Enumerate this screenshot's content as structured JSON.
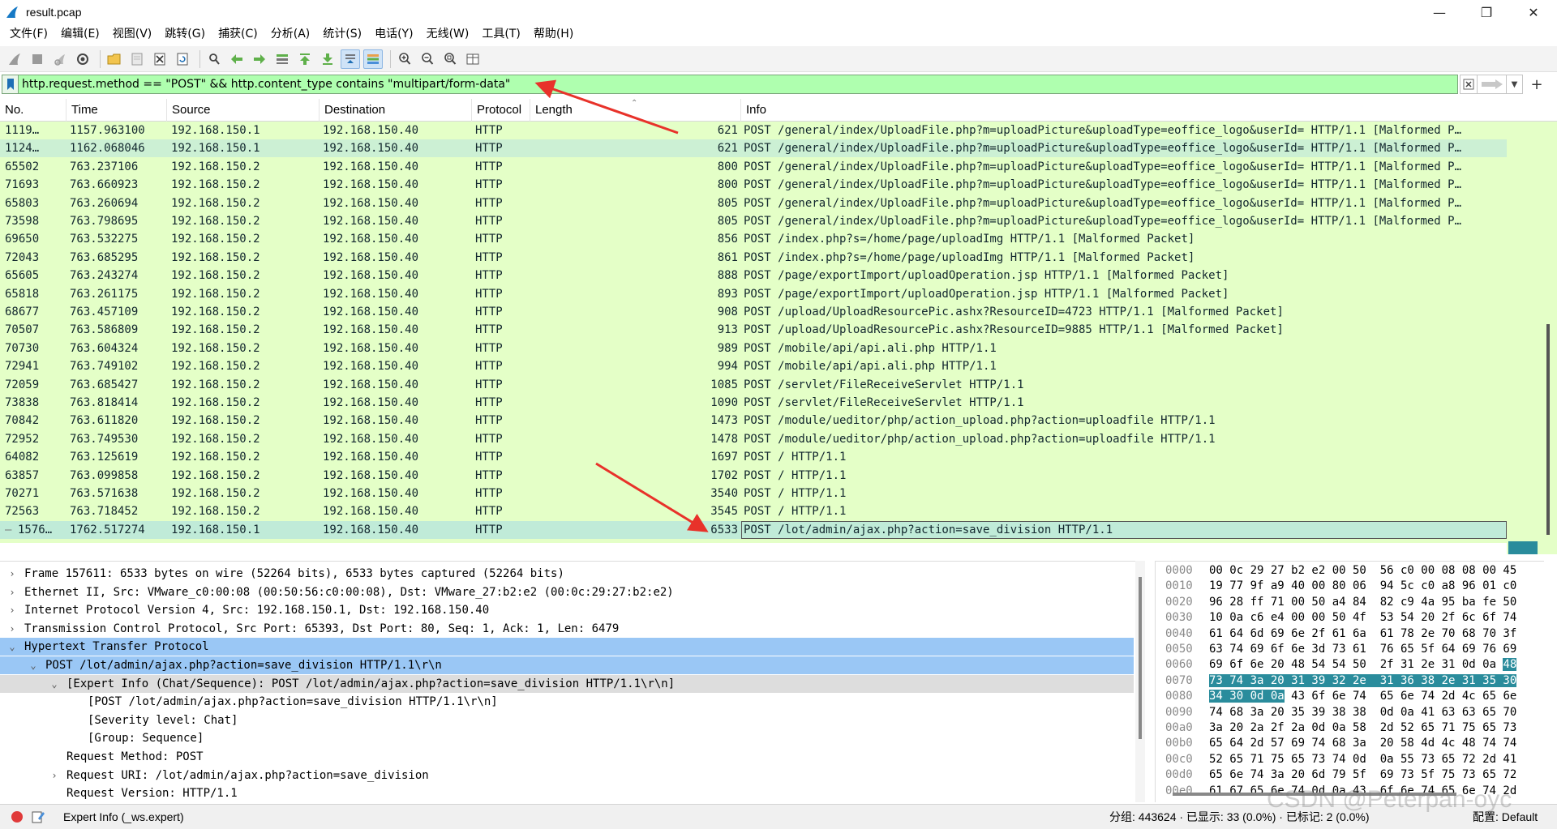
{
  "window": {
    "title": "result.pcap",
    "minimize": "—",
    "restore": "❐",
    "close": "✕"
  },
  "menu": [
    "文件(F)",
    "编辑(E)",
    "视图(V)",
    "跳转(G)",
    "捕获(C)",
    "分析(A)",
    "统计(S)",
    "电话(Y)",
    "无线(W)",
    "工具(T)",
    "帮助(H)"
  ],
  "toolbar_icons": [
    "shark-fin-start-icon",
    "stop-icon",
    "restart-icon",
    "capture-options-icon",
    "open-folder-icon",
    "save-file-icon",
    "close-file-icon",
    "reload-icon",
    "find-packet-icon",
    "go-back-icon",
    "go-forward-icon",
    "go-to-packet-icon",
    "go-first-icon",
    "go-last-icon",
    "autoscroll-icon",
    "colorize-icon",
    "zoom-in-icon",
    "zoom-out-icon",
    "zoom-reset-icon",
    "resize-columns-icon"
  ],
  "filter": {
    "value": "http.request.method == \"POST\" && http.content_type contains \"multipart/form-data\"",
    "plus": "+"
  },
  "columns": [
    "No.",
    "Time",
    "Source",
    "Destination",
    "Protocol",
    "Length",
    "Info"
  ],
  "packets": [
    {
      "no": "1119…",
      "time": "1157.963100",
      "src": "192.168.150.1",
      "dst": "192.168.150.40",
      "proto": "HTTP",
      "len": "621",
      "info": "POST /general/index/UploadFile.php?m=uploadPicture&uploadType=eoffice_logo&userId= HTTP/1.1 [Malformed P…"
    },
    {
      "no": "1124…",
      "time": "1162.068046",
      "src": "192.168.150.1",
      "dst": "192.168.150.40",
      "proto": "HTTP",
      "len": "621",
      "info": "POST /general/index/UploadFile.php?m=uploadPicture&uploadType=eoffice_logo&userId= HTTP/1.1 [Malformed P…"
    },
    {
      "no": "65502",
      "time": "763.237106",
      "src": "192.168.150.2",
      "dst": "192.168.150.40",
      "proto": "HTTP",
      "len": "800",
      "info": "POST /general/index/UploadFile.php?m=uploadPicture&uploadType=eoffice_logo&userId= HTTP/1.1 [Malformed P…"
    },
    {
      "no": "71693",
      "time": "763.660923",
      "src": "192.168.150.2",
      "dst": "192.168.150.40",
      "proto": "HTTP",
      "len": "800",
      "info": "POST /general/index/UploadFile.php?m=uploadPicture&uploadType=eoffice_logo&userId= HTTP/1.1 [Malformed P…"
    },
    {
      "no": "65803",
      "time": "763.260694",
      "src": "192.168.150.2",
      "dst": "192.168.150.40",
      "proto": "HTTP",
      "len": "805",
      "info": "POST /general/index/UploadFile.php?m=uploadPicture&uploadType=eoffice_logo&userId= HTTP/1.1 [Malformed P…"
    },
    {
      "no": "73598",
      "time": "763.798695",
      "src": "192.168.150.2",
      "dst": "192.168.150.40",
      "proto": "HTTP",
      "len": "805",
      "info": "POST /general/index/UploadFile.php?m=uploadPicture&uploadType=eoffice_logo&userId= HTTP/1.1 [Malformed P…"
    },
    {
      "no": "69650",
      "time": "763.532275",
      "src": "192.168.150.2",
      "dst": "192.168.150.40",
      "proto": "HTTP",
      "len": "856",
      "info": "POST /index.php?s=/home/page/uploadImg HTTP/1.1 [Malformed Packet]"
    },
    {
      "no": "72043",
      "time": "763.685295",
      "src": "192.168.150.2",
      "dst": "192.168.150.40",
      "proto": "HTTP",
      "len": "861",
      "info": "POST /index.php?s=/home/page/uploadImg HTTP/1.1 [Malformed Packet]"
    },
    {
      "no": "65605",
      "time": "763.243274",
      "src": "192.168.150.2",
      "dst": "192.168.150.40",
      "proto": "HTTP",
      "len": "888",
      "info": "POST /page/exportImport/uploadOperation.jsp HTTP/1.1 [Malformed Packet]"
    },
    {
      "no": "65818",
      "time": "763.261175",
      "src": "192.168.150.2",
      "dst": "192.168.150.40",
      "proto": "HTTP",
      "len": "893",
      "info": "POST /page/exportImport/uploadOperation.jsp HTTP/1.1 [Malformed Packet]"
    },
    {
      "no": "68677",
      "time": "763.457109",
      "src": "192.168.150.2",
      "dst": "192.168.150.40",
      "proto": "HTTP",
      "len": "908",
      "info": "POST /upload/UploadResourcePic.ashx?ResourceID=4723 HTTP/1.1 [Malformed Packet]"
    },
    {
      "no": "70507",
      "time": "763.586809",
      "src": "192.168.150.2",
      "dst": "192.168.150.40",
      "proto": "HTTP",
      "len": "913",
      "info": "POST /upload/UploadResourcePic.ashx?ResourceID=9885 HTTP/1.1 [Malformed Packet]"
    },
    {
      "no": "70730",
      "time": "763.604324",
      "src": "192.168.150.2",
      "dst": "192.168.150.40",
      "proto": "HTTP",
      "len": "989",
      "info": "POST /mobile/api/api.ali.php HTTP/1.1"
    },
    {
      "no": "72941",
      "time": "763.749102",
      "src": "192.168.150.2",
      "dst": "192.168.150.40",
      "proto": "HTTP",
      "len": "994",
      "info": "POST /mobile/api/api.ali.php HTTP/1.1"
    },
    {
      "no": "72059",
      "time": "763.685427",
      "src": "192.168.150.2",
      "dst": "192.168.150.40",
      "proto": "HTTP",
      "len": "1085",
      "info": "POST /servlet/FileReceiveServlet HTTP/1.1"
    },
    {
      "no": "73838",
      "time": "763.818414",
      "src": "192.168.150.2",
      "dst": "192.168.150.40",
      "proto": "HTTP",
      "len": "1090",
      "info": "POST /servlet/FileReceiveServlet HTTP/1.1"
    },
    {
      "no": "70842",
      "time": "763.611820",
      "src": "192.168.150.2",
      "dst": "192.168.150.40",
      "proto": "HTTP",
      "len": "1473",
      "info": "POST /module/ueditor/php/action_upload.php?action=uploadfile HTTP/1.1"
    },
    {
      "no": "72952",
      "time": "763.749530",
      "src": "192.168.150.2",
      "dst": "192.168.150.40",
      "proto": "HTTP",
      "len": "1478",
      "info": "POST /module/ueditor/php/action_upload.php?action=uploadfile HTTP/1.1"
    },
    {
      "no": "64082",
      "time": "763.125619",
      "src": "192.168.150.2",
      "dst": "192.168.150.40",
      "proto": "HTTP",
      "len": "1697",
      "info": "POST / HTTP/1.1"
    },
    {
      "no": "63857",
      "time": "763.099858",
      "src": "192.168.150.2",
      "dst": "192.168.150.40",
      "proto": "HTTP",
      "len": "1702",
      "info": "POST / HTTP/1.1"
    },
    {
      "no": "70271",
      "time": "763.571638",
      "src": "192.168.150.2",
      "dst": "192.168.150.40",
      "proto": "HTTP",
      "len": "3540",
      "info": "POST / HTTP/1.1"
    },
    {
      "no": "72563",
      "time": "763.718452",
      "src": "192.168.150.2",
      "dst": "192.168.150.40",
      "proto": "HTTP",
      "len": "3545",
      "info": "POST / HTTP/1.1"
    },
    {
      "no": "1576…",
      "time": "1762.517274",
      "src": "192.168.150.1",
      "dst": "192.168.150.40",
      "proto": "HTTP",
      "len": "6533",
      "info": "POST /lot/admin/ajax.php?action=save_division HTTP/1.1"
    }
  ],
  "selected_packet_index": 22,
  "details": [
    {
      "text": "Frame 157611: 6533 bytes on wire (52264 bits), 6533 bytes captured (52264 bits)",
      "arrow": ">",
      "indent": 0,
      "style": ""
    },
    {
      "text": "Ethernet II, Src: VMware_c0:00:08 (00:50:56:c0:00:08), Dst: VMware_27:b2:e2 (00:0c:29:27:b2:e2)",
      "arrow": ">",
      "indent": 0,
      "style": ""
    },
    {
      "text": "Internet Protocol Version 4, Src: 192.168.150.1, Dst: 192.168.150.40",
      "arrow": ">",
      "indent": 0,
      "style": ""
    },
    {
      "text": "Transmission Control Protocol, Src Port: 65393, Dst Port: 80, Seq: 1, Ack: 1, Len: 6479",
      "arrow": ">",
      "indent": 0,
      "style": ""
    },
    {
      "text": "Hypertext Transfer Protocol",
      "arrow": "v",
      "indent": 0,
      "style": "blue"
    },
    {
      "text": "POST /lot/admin/ajax.php?action=save_division HTTP/1.1\\r\\n",
      "arrow": "v",
      "indent": 1,
      "style": "blue"
    },
    {
      "text": "[Expert Info (Chat/Sequence): POST /lot/admin/ajax.php?action=save_division HTTP/1.1\\r\\n]",
      "arrow": "v",
      "indent": 2,
      "style": "gray"
    },
    {
      "text": "[POST /lot/admin/ajax.php?action=save_division HTTP/1.1\\r\\n]",
      "arrow": "",
      "indent": 3,
      "style": ""
    },
    {
      "text": "[Severity level: Chat]",
      "arrow": "",
      "indent": 3,
      "style": ""
    },
    {
      "text": "[Group: Sequence]",
      "arrow": "",
      "indent": 3,
      "style": ""
    },
    {
      "text": "Request Method: POST",
      "arrow": "",
      "indent": 2,
      "style": ""
    },
    {
      "text": "Request URI: /lot/admin/ajax.php?action=save_division",
      "arrow": ">",
      "indent": 2,
      "style": ""
    },
    {
      "text": "Request Version: HTTP/1.1",
      "arrow": "",
      "indent": 2,
      "style": ""
    }
  ],
  "bytes": [
    {
      "off": "0000",
      "pre": "00 0c 29 27 b2 e2 00 50  56 c0 00 08 08 00 45",
      "sel": "",
      "post": ""
    },
    {
      "off": "0010",
      "pre": "19 77 9f a9 40 00 80 06  94 5c c0 a8 96 01 c0",
      "sel": "",
      "post": ""
    },
    {
      "off": "0020",
      "pre": "96 28 ff 71 00 50 a4 84  82 c9 4a 95 ba fe 50",
      "sel": "",
      "post": ""
    },
    {
      "off": "0030",
      "pre": "10 0a c6 e4 00 00 50 4f  53 54 20 2f 6c 6f 74",
      "sel": "",
      "post": ""
    },
    {
      "off": "0040",
      "pre": "61 64 6d 69 6e 2f 61 6a  61 78 2e 70 68 70 3f",
      "sel": "",
      "post": ""
    },
    {
      "off": "0050",
      "pre": "63 74 69 6f 6e 3d 73 61  76 65 5f 64 69 76 69",
      "sel": "",
      "post": ""
    },
    {
      "off": "0060",
      "pre": "69 6f 6e 20 48 54 54 50  2f 31 2e 31 0d 0a ",
      "sel": "48",
      "post": ""
    },
    {
      "off": "0070",
      "pre": "",
      "sel": "73 74 3a 20 31 39 32 2e  31 36 38 2e 31 35 30",
      "post": ""
    },
    {
      "off": "0080",
      "pre": "",
      "sel": "34 30 0d 0a",
      "post": " 43 6f 6e 74  65 6e 74 2d 4c 65 6e"
    },
    {
      "off": "0090",
      "pre": "74 68 3a 20 35 39 38 38  0d 0a 41 63 63 65 70",
      "sel": "",
      "post": ""
    },
    {
      "off": "00a0",
      "pre": "3a 20 2a 2f 2a 0d 0a 58  2d 52 65 71 75 65 73",
      "sel": "",
      "post": ""
    },
    {
      "off": "00b0",
      "pre": "65 64 2d 57 69 74 68 3a  20 58 4d 4c 48 74 74",
      "sel": "",
      "post": ""
    },
    {
      "off": "00c0",
      "pre": "52 65 71 75 65 73 74 0d  0a 55 73 65 72 2d 41",
      "sel": "",
      "post": ""
    },
    {
      "off": "00d0",
      "pre": "65 6e 74 3a 20 6d 79 5f  69 73 5f 75 73 65 72",
      "sel": "",
      "post": ""
    },
    {
      "off": "00e0",
      "pre": "61 67 65 6e 74 0d 0a 43  6f 6e 74 65 6e 74 2d",
      "sel": "",
      "post": ""
    }
  ],
  "status": {
    "expert": "Expert Info (_ws.expert)",
    "stats": "分组: 443624 · 已显示: 33 (0.0%) · 已标记: 2 (0.0%)",
    "profile": "配置: Default"
  },
  "watermark": "CSDN @Peterpan-oyc",
  "colors": {
    "packet_bg": "#e4ffc7",
    "selected_row": "#c0ebd8",
    "filter_bg": "#afffaf",
    "tree_highlight": "#9ac7f5",
    "bytes_selected": "#2a8c9c",
    "arrow_red": "#e8322a"
  }
}
